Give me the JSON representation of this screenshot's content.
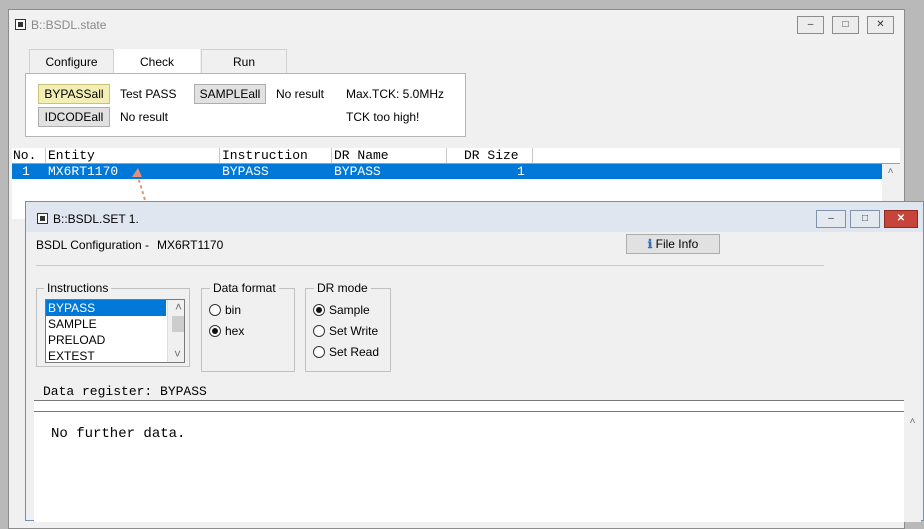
{
  "main_window": {
    "title": "B::BSDL.state",
    "tabs": [
      {
        "label": "Configure",
        "active": false
      },
      {
        "label": "Check",
        "active": true
      },
      {
        "label": "Run",
        "active": false
      }
    ],
    "check_panel": {
      "bypass_button": "BYPASSall",
      "bypass_result": "Test PASS",
      "sample_button": "SAMPLEall",
      "sample_result": "No result",
      "max_tck": "Max.TCK: 5.0MHz",
      "idcode_button": "IDCODEall",
      "idcode_result": "No result",
      "tck_status": "TCK too high!"
    },
    "table": {
      "columns": [
        "No.",
        "Entity",
        "Instruction",
        "DR Name",
        "DR Size"
      ],
      "rows": [
        {
          "no": "1",
          "entity": "MX6RT1170",
          "instruction": "BYPASS",
          "dr_name": "BYPASS",
          "dr_size": "1"
        }
      ]
    }
  },
  "popup_window": {
    "title": "B::BSDL.SET 1.",
    "config_label": "BSDL Configuration -",
    "entity_name": "MX6RT1170",
    "file_info_button": "File Info",
    "instructions": {
      "legend": "Instructions",
      "items": [
        "BYPASS",
        "SAMPLE",
        "PRELOAD",
        "EXTEST"
      ],
      "selected": "BYPASS"
    },
    "data_format": {
      "legend": "Data format",
      "options": [
        "bin",
        "hex"
      ],
      "selected": "hex"
    },
    "dr_mode": {
      "legend": "DR mode",
      "options": [
        "Sample",
        "Set Write",
        "Set Read"
      ],
      "selected": "Sample"
    },
    "data_register_label": "Data register: BYPASS",
    "message": "No further data."
  },
  "colors": {
    "selection": "#0078d7",
    "bypass_button_bg": "#f2eeb4",
    "link_arrow": "#e0917a"
  }
}
